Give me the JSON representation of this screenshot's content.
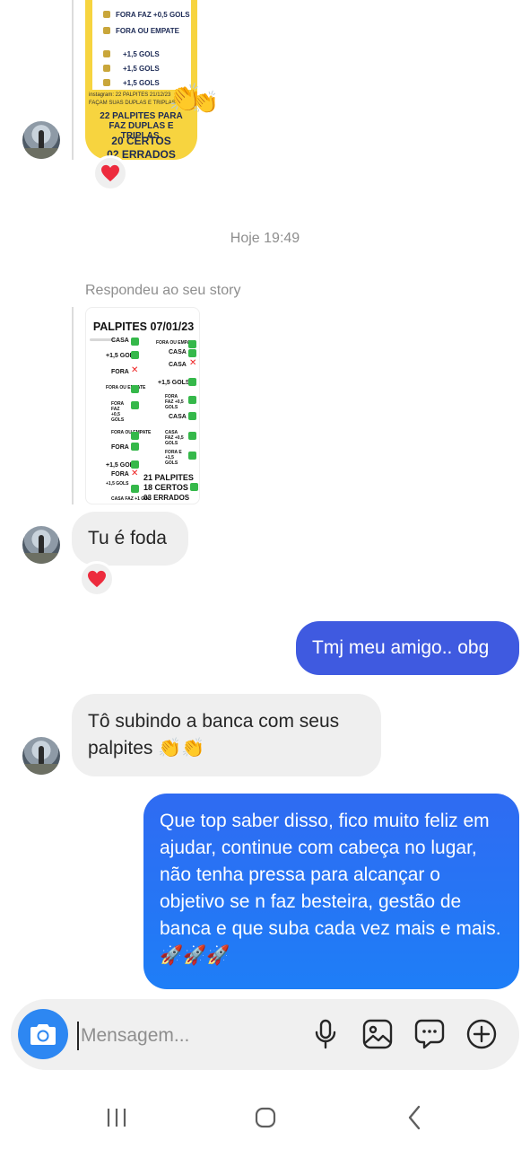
{
  "thread": {
    "timestamp": "Hoje 19:49",
    "replied_label": "Respondeu ao seu story"
  },
  "top_image": {
    "rows": [
      "FORA FAZ +0,5 GOLS",
      "FORA OU EMPATE",
      "+1,5 GOLS",
      "+1,5 GOLS",
      "+1,5 GOLS"
    ],
    "footer_line1": "instagram: 22 PALPITES 21/12/23",
    "footer_line2": "FAÇAM SUAS DUPLAS E TRIPLAS",
    "headline": "22 PALPITES PARA FAZ DUPLAS E TRIPLAS.",
    "hits": "20 CERTOS",
    "misses": "02 ERRADOS",
    "emoji": "👏"
  },
  "story_image": {
    "title": "PALPITES 07/01/23",
    "left_labels": [
      "CASA",
      "+1,5 GOLS",
      "FORA",
      "FORA OU EMPATE",
      "FORA FAZ +0,5 GOLS",
      "FORA OU EMPATE",
      "FORA",
      "+1,5 GOLS",
      "FORA",
      "+1,5 GOLS",
      "CASA FAZ +1 GOL"
    ],
    "right_labels": [
      "FORA OU EMPATE",
      "CASA",
      "CASA",
      "+1,5 GOLS",
      "FORA FAZ +0,5 GOLS",
      "CASA",
      "CASA FAZ +0,5 GOLS",
      "FORA E +1,5 GOLS"
    ],
    "summary1": "21 PALPITES",
    "summary2": "18 CERTOS",
    "summary3": "03 ERRADOS"
  },
  "messages": [
    {
      "from": "them",
      "text": "Tu é foda"
    },
    {
      "from": "me",
      "text": "Tmj meu amigo.. obg"
    },
    {
      "from": "them",
      "text": "Tô subindo a banca com seus palpites 👏👏"
    },
    {
      "from": "me",
      "text": "Que top saber disso, fico muito feliz em ajudar, continue com cabeça no lugar, não tenha pressa para alcançar o objetivo se n faz besteira,  gestão de banca e que suba cada vez mais e mais. 🚀🚀🚀"
    }
  ],
  "composer": {
    "placeholder": "Mensagem..."
  },
  "colors": {
    "outgoing": "#3f5ae0",
    "outgoing_gradient": "#1e7ef7",
    "incoming": "#efefef",
    "camera": "#2d87f2",
    "heart": "#ed2b3d"
  }
}
